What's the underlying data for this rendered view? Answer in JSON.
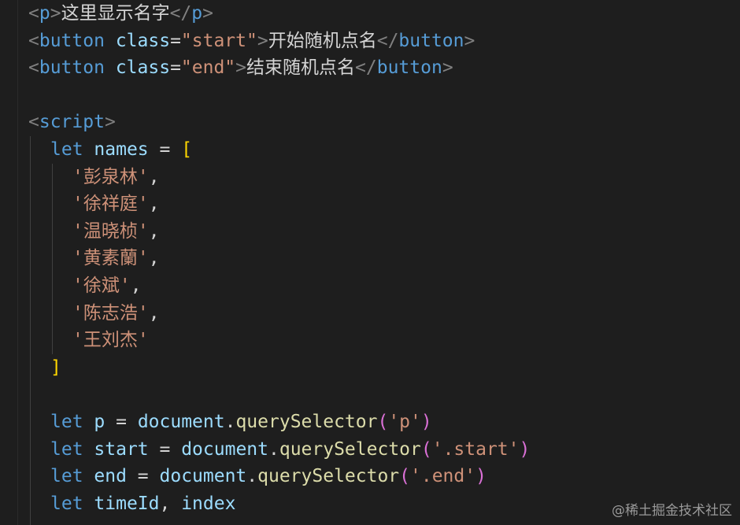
{
  "editor": {
    "lines": {
      "l1": {
        "open": "<",
        "tag": "p",
        "close": ">",
        "text": "这里显示名字",
        "end_open": "</",
        "end_tag": "p",
        "end_close": ">"
      },
      "l2": {
        "open": "<",
        "tag": "button",
        "attr": "class",
        "eq": "=",
        "val": "\"start\"",
        "close": ">",
        "text": "开始随机点名",
        "end_open": "</",
        "end_tag": "button",
        "end_close": ">"
      },
      "l3": {
        "open": "<",
        "tag": "button",
        "attr": "class",
        "eq": "=",
        "val": "\"end\"",
        "close": ">",
        "text": "结束随机点名",
        "end_open": "</",
        "end_tag": "button",
        "end_close": ">"
      },
      "l5": {
        "open": "<",
        "tag": "script",
        "close": ">"
      },
      "l6": {
        "kw": "let",
        "var": "names",
        "eq": " = ",
        "br": "["
      },
      "names": [
        "'彭泉林'",
        "'徐祥庭'",
        "'温晓桢'",
        "'黄素蘭'",
        "'徐斌'",
        "'陈志浩'",
        "'王刘杰'"
      ],
      "comma": ",",
      "l14": {
        "br": "]"
      },
      "l16": {
        "kw": "let",
        "var": "p",
        "eq": " = ",
        "obj": "document",
        "dot": ".",
        "fn": "querySelector",
        "po": "(",
        "arg": "'p'",
        "pc": ")"
      },
      "l17": {
        "kw": "let",
        "var": "start",
        "eq": " = ",
        "obj": "document",
        "dot": ".",
        "fn": "querySelector",
        "po": "(",
        "arg": "'.start'",
        "pc": ")"
      },
      "l18": {
        "kw": "let",
        "var": "end",
        "eq": " = ",
        "obj": "document",
        "dot": ".",
        "fn": "querySelector",
        "po": "(",
        "arg": "'.end'",
        "pc": ")"
      },
      "l19": {
        "kw": "let",
        "var1": "timeId",
        "sep": ", ",
        "var2": "index"
      }
    }
  },
  "watermark": "@稀土掘金技术社区",
  "colors": {
    "background": "#1e1e1e",
    "tag": "#569cd6",
    "attribute": "#9cdcfe",
    "string": "#ce9178",
    "function": "#dcdcaa",
    "bracket": "#ffd700"
  }
}
